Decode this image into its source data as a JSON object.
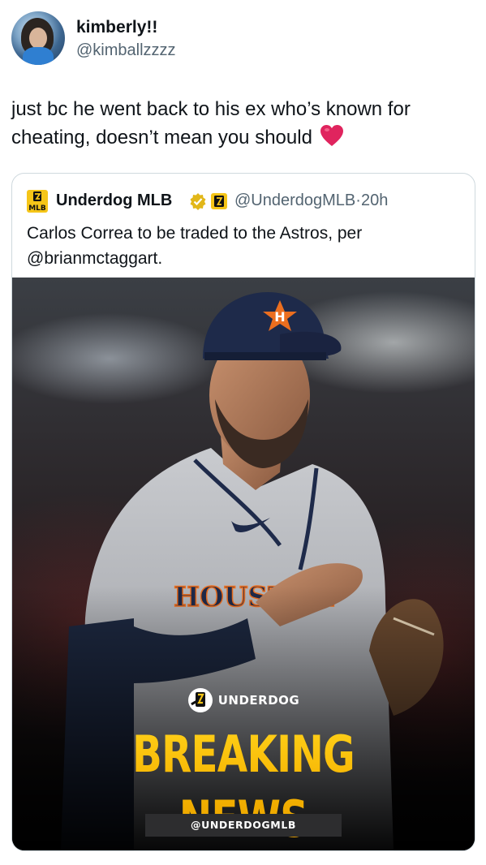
{
  "author": {
    "display_name": "kimberly!!",
    "handle": "@kimballzzzz",
    "avatar_icon": "profile-photo"
  },
  "tweet": {
    "text": "just bc he went back to his ex who’s known for cheating, doesn’t mean you should",
    "emoji": "red-heart-icon"
  },
  "quoted_tweet": {
    "display_name": "Underdog MLB",
    "handle": "@UnderdogMLB",
    "separator": "·",
    "time": "20h",
    "text": "Carlos Correa to be traded to the Astros, per @brianmctaggart.",
    "media": {
      "brand": "UNDERDOG",
      "headline": "BREAKING NEWS",
      "handle": "@UNDERDOGMLB"
    }
  },
  "colors": {
    "text": "#0f1419",
    "secondary": "#536471",
    "border": "#cfd9de",
    "headline": "#f5b800",
    "verified_gold": "#e2b719",
    "heart": "#e0245e"
  }
}
